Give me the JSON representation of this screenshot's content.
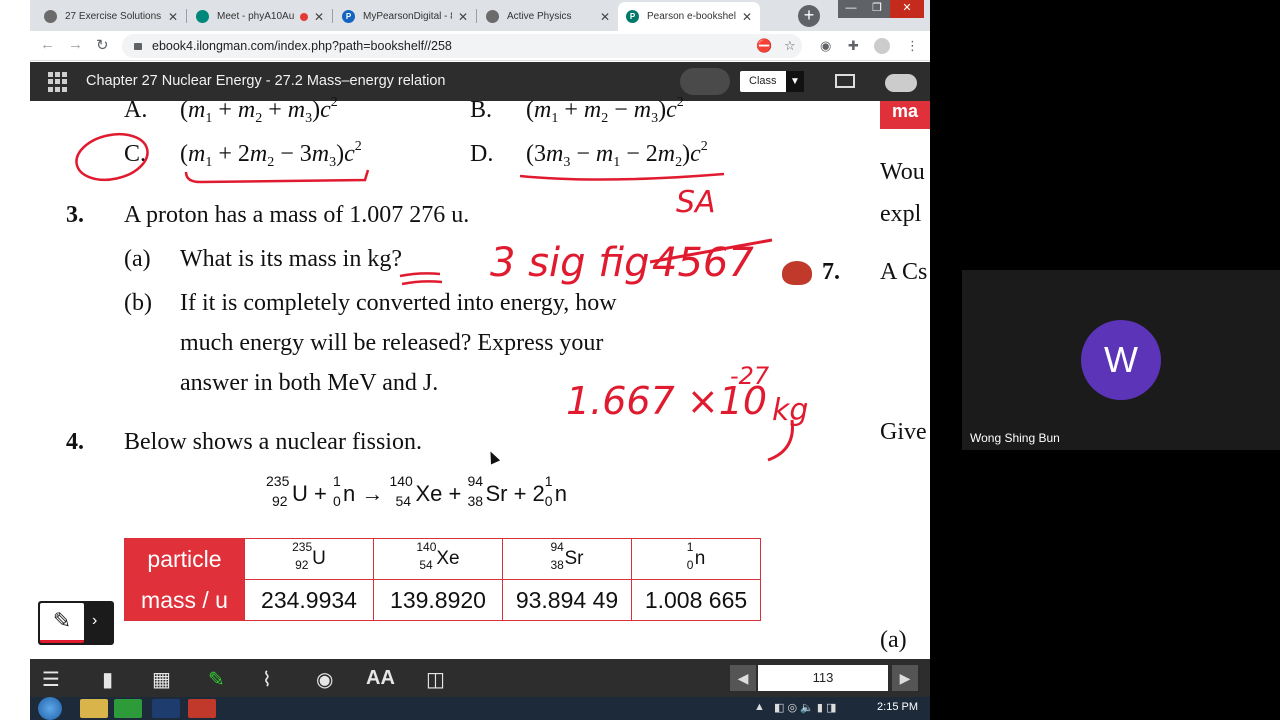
{
  "browser": {
    "tabs": [
      {
        "title": "27 Exercise Solutions",
        "favicon_color": "#5f6368",
        "active": false
      },
      {
        "title": "Meet - phyA10Au",
        "favicon_color": "#00897b",
        "active": false
      },
      {
        "title": "MyPearsonDigital - 8",
        "favicon_color": "#1565c0",
        "active": false
      },
      {
        "title": "Active Physics",
        "favicon_color": "#5f6368",
        "active": false
      },
      {
        "title": "Pearson e-bookshelf",
        "favicon_color": "#00796b",
        "active": true
      }
    ],
    "new_tab": "+",
    "url": "ebook4.ilongman.com/index.php?path=bookshelf//258"
  },
  "ebook": {
    "chapter_title": "Chapter 27 Nuclear Energy  -  27.2 Mass–energy relation",
    "class_label": "Class",
    "page_number": "113"
  },
  "content": {
    "optA": "A.",
    "optB": "B.",
    "optC": "C.",
    "optD": "D.",
    "q3_num": "3.",
    "q3_text": "A proton has a mass of 1.007 276 u.",
    "q3a_label": "(a)",
    "q3a_text": "What is its mass in kg?",
    "q3b_label": "(b)",
    "q3b_line1": "If it is completely converted into energy, how",
    "q3b_line2": "much energy will be released? Express your",
    "q3b_line3": "answer in both MeV and J.",
    "q4_num": "4.",
    "q4_text": "Below shows a nuclear fission.",
    "right_tab": "ma",
    "right_wou": "Wou",
    "right_expl": "expl",
    "q7_num": "7.",
    "right_ac": "A Cs",
    "right_give": "Give",
    "right_a": "(a)",
    "table": {
      "header_label": "particle",
      "row_label": "mass / u",
      "values": [
        "234.9934",
        "139.8920",
        "93.894 49",
        "1.008 665"
      ]
    }
  },
  "handwriting": {
    "sa": "SA",
    "sig_fig": "3 sig fig",
    "crossed": "4567",
    "mass": "1.667 ×10",
    "exp": "-27",
    "unit": "kg"
  },
  "taskbar": {
    "time": "2:15 PM"
  },
  "participant": {
    "initial": "W",
    "name": "Wong Shing Bun",
    "avatar_color": "#5c34b8"
  }
}
